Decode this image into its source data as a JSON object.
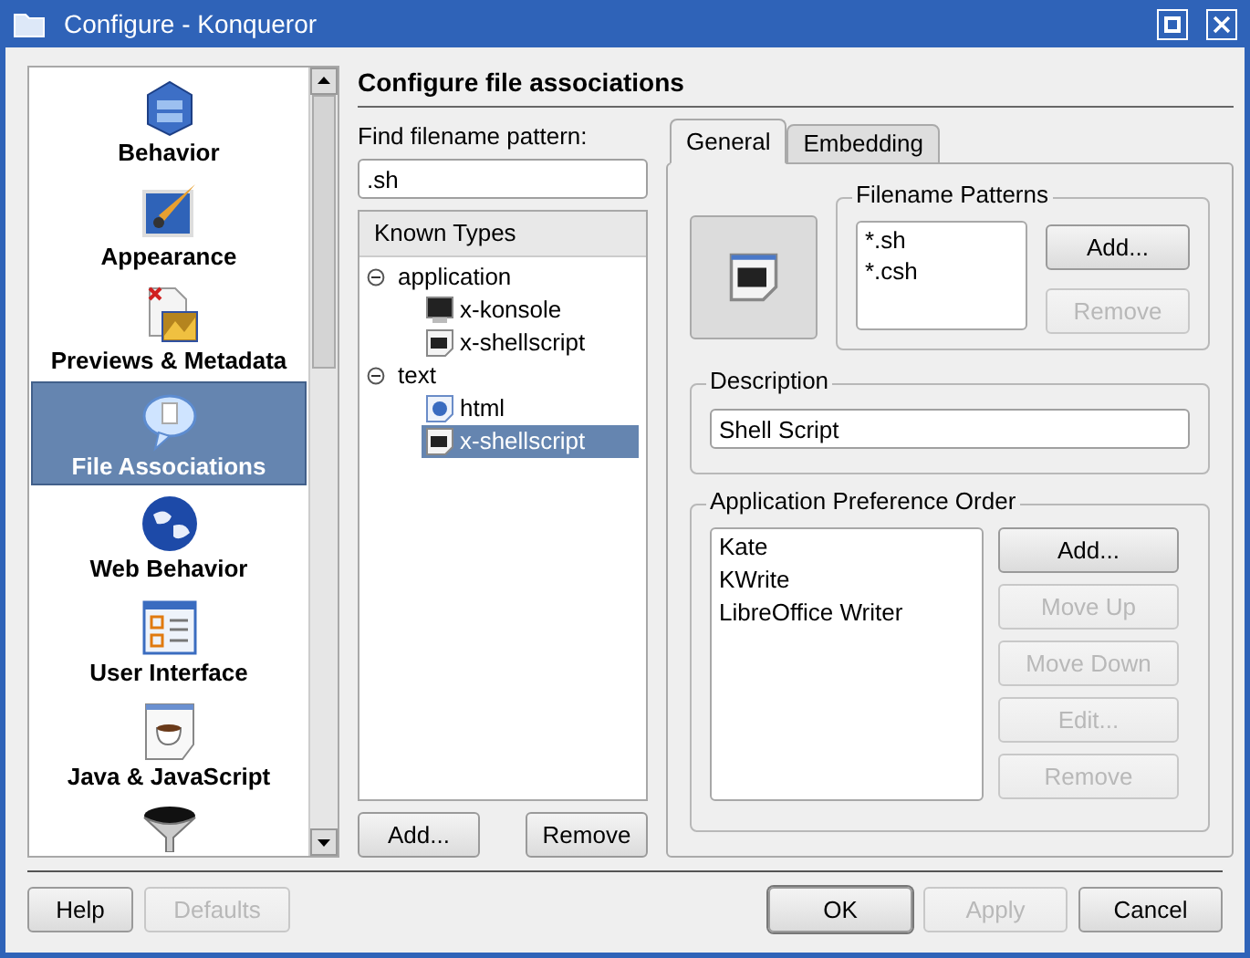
{
  "window": {
    "title": "Configure - Konqueror"
  },
  "sidebar": {
    "items": [
      {
        "kind": "cabinet",
        "label": "Behavior",
        "selected": false
      },
      {
        "kind": "brush",
        "label": "Appearance",
        "selected": false
      },
      {
        "kind": "preview",
        "label": "Previews & Metadata",
        "selected": false
      },
      {
        "kind": "bubble",
        "label": "File Associations",
        "selected": true
      },
      {
        "kind": "globe",
        "label": "Web Behavior",
        "selected": false
      },
      {
        "kind": "ui",
        "label": "User Interface",
        "selected": false
      },
      {
        "kind": "java",
        "label": "Java & JavaScript",
        "selected": false
      },
      {
        "kind": "funnel",
        "selected": false
      }
    ]
  },
  "heading": "Configure file associations",
  "search": {
    "label": "Find filename pattern:",
    "value": ".sh"
  },
  "tree": {
    "header": "Known Types",
    "items": [
      {
        "label": "application",
        "expanded": true,
        "selected": false,
        "children": [
          {
            "label": "x-konsole",
            "kind": "terminal",
            "selected": false
          },
          {
            "label": "x-shellscript",
            "kind": "script",
            "selected": false
          }
        ]
      },
      {
        "label": "text",
        "expanded": true,
        "selected": false,
        "children": [
          {
            "label": "html",
            "kind": "web",
            "selected": false
          },
          {
            "label": "x-shellscript",
            "kind": "script",
            "selected": true
          }
        ]
      }
    ]
  },
  "tree_buttons": [
    {
      "label": "Add...",
      "disabled": false
    },
    {
      "label": "Remove",
      "disabled": false
    }
  ],
  "tabs": [
    {
      "label": "General",
      "selected": true
    },
    {
      "label": "Embedding",
      "selected": false
    }
  ],
  "filename_patterns": {
    "title": "Filename Patterns",
    "items": [
      "*.sh",
      "*.csh"
    ],
    "buttons": [
      {
        "label": "Add...",
        "disabled": false
      },
      {
        "label": "Remove",
        "disabled": true
      }
    ]
  },
  "description": {
    "title": "Description",
    "value": "Shell Script"
  },
  "application_order": {
    "title": "Application Preference Order",
    "items": [
      "Kate",
      "KWrite",
      "LibreOffice Writer"
    ],
    "buttons": [
      {
        "label": "Add...",
        "disabled": false
      },
      {
        "label": "Move Up",
        "disabled": true
      },
      {
        "label": "Move Down",
        "disabled": true
      },
      {
        "label": "Edit...",
        "disabled": true
      },
      {
        "label": "Remove",
        "disabled": true
      }
    ]
  },
  "footer": {
    "left": [
      {
        "label": "Help",
        "disabled": false,
        "default": false
      },
      {
        "label": "Defaults",
        "disabled": true,
        "default": false
      }
    ],
    "right": [
      {
        "label": "OK",
        "disabled": false,
        "default": true
      },
      {
        "label": "Apply",
        "disabled": true,
        "default": false
      },
      {
        "label": "Cancel",
        "disabled": false,
        "default": false
      }
    ]
  }
}
